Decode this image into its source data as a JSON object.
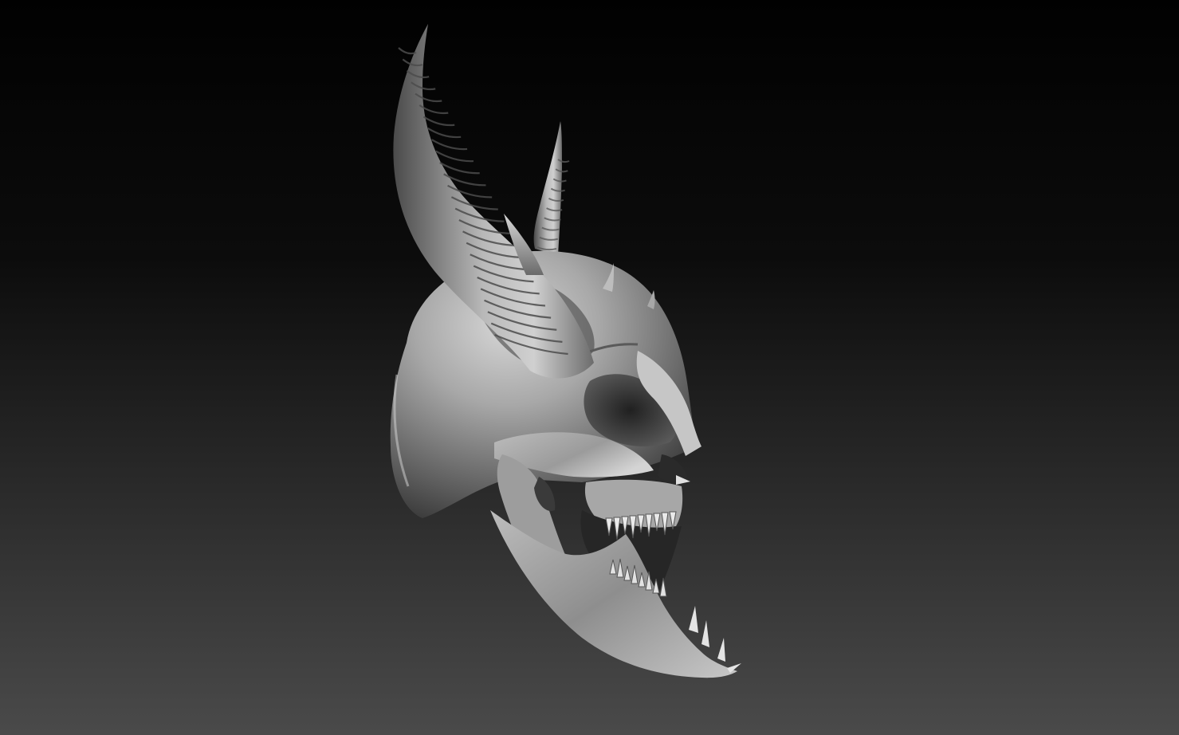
{
  "scene": {
    "subject": "sculpted-skull",
    "colors": {
      "background_top": "#010101",
      "background_bottom": "#4a4a4a",
      "mesh_highlight": "#d2d2d2",
      "mesh_mid": "#9a9a9a",
      "mesh_shadow": "#3d3d3d",
      "mesh_deep": "#1c1c1c"
    }
  }
}
